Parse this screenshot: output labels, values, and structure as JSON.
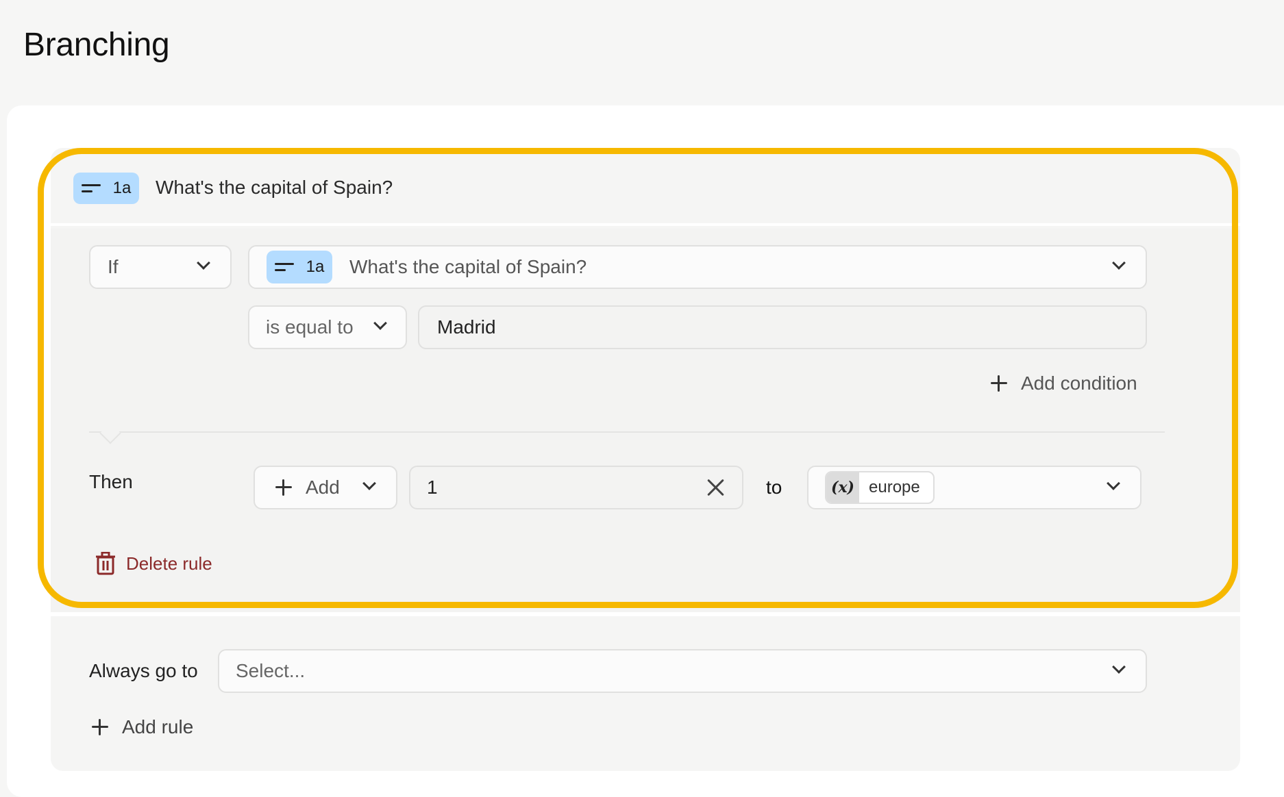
{
  "page": {
    "title": "Branching"
  },
  "question": {
    "badge": "1a",
    "title": "What's the capital of Spain?"
  },
  "condition": {
    "if_label": "If",
    "question_badge": "1a",
    "question_text": "What's the capital of Spain?",
    "operator": "is equal to",
    "value": "Madrid",
    "add_condition": "Add condition"
  },
  "action": {
    "then_label": "Then",
    "add_label": "Add",
    "amount": "1",
    "to_label": "to",
    "variable_icon": "(x)",
    "variable_name": "europe"
  },
  "delete_rule": "Delete rule",
  "always": {
    "label": "Always go to",
    "placeholder": "Select..."
  },
  "add_rule": "Add rule",
  "colors": {
    "highlight": "#f6b800",
    "badge": "#b4dcff",
    "delete": "#8b2a2a"
  }
}
